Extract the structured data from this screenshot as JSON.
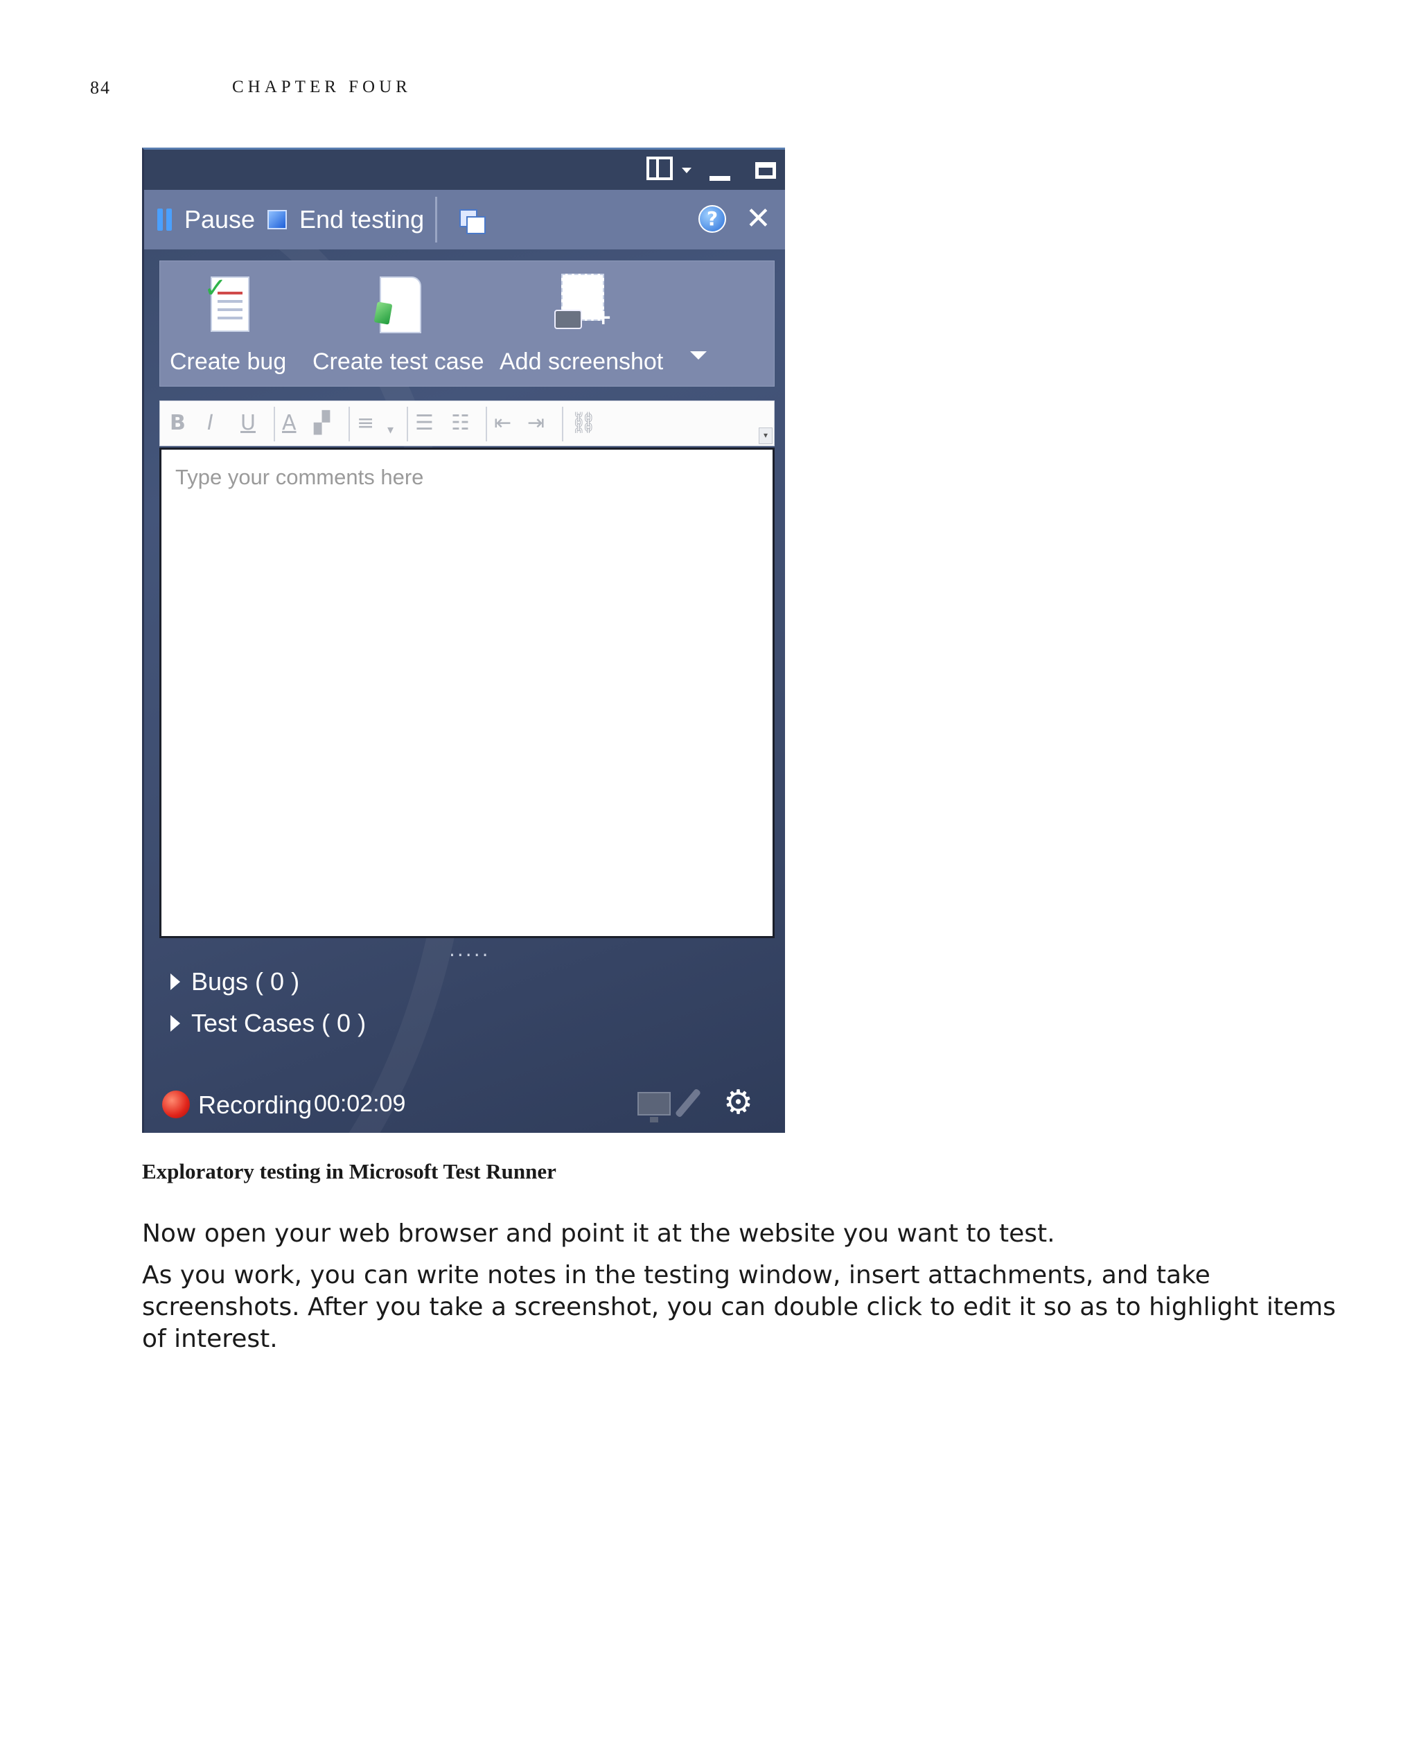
{
  "page": {
    "number": "84",
    "running_head": "CHAPTER FOUR"
  },
  "window": {
    "toolbar": {
      "pause_label": "Pause",
      "end_testing_label": "End testing",
      "help_glyph": "?",
      "close_glyph": "✕"
    },
    "actions": {
      "create_bug_label": "Create bug",
      "create_test_case_label": "Create test case",
      "add_screenshot_label": "Add screenshot"
    },
    "editor": {
      "bold": "B",
      "italic": "I",
      "underline": "U",
      "font_color": "A",
      "placeholder": "Type your comments here"
    },
    "sections": [
      {
        "label": "Bugs ( 0 )"
      },
      {
        "label": "Test Cases ( 0 )"
      }
    ],
    "status": {
      "recording_label": "Recording",
      "elapsed_time": "00:02:09",
      "accent_color": "#e0241a"
    }
  },
  "caption": "Exploratory testing in Microsoft Test Runner",
  "paragraphs": [
    "Now open your web browser and point it at the website you want to test.",
    "As you work, you can write notes in the testing window, insert attachments, and take screenshots. After you take a screenshot, you can double click to edit it so as to highlight items of interest."
  ]
}
